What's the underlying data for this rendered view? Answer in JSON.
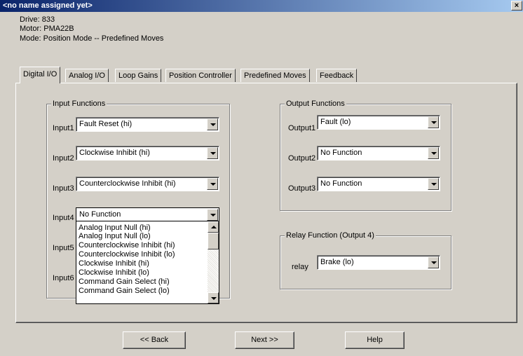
{
  "window": {
    "title": "<no name assigned yet>",
    "close_label": "×"
  },
  "info": {
    "drive": "Drive: 833",
    "motor": "Motor: PMA22B",
    "mode": "Mode: Position Mode -- Predefined Moves"
  },
  "tabs": [
    {
      "label": "Digital I/O",
      "active": true
    },
    {
      "label": "Analog I/O"
    },
    {
      "label": "Loop Gains"
    },
    {
      "label": "Position Controller"
    },
    {
      "label": "Predefined Moves"
    },
    {
      "label": "Feedback"
    }
  ],
  "input_functions": {
    "title": "Input Functions",
    "rows": [
      {
        "label": "Input1",
        "value": "Fault Reset (hi)"
      },
      {
        "label": "Input2",
        "value": "Clockwise Inhibit (hi)"
      },
      {
        "label": "Input3",
        "value": "Counterclockwise Inhibit (hi)"
      },
      {
        "label": "Input4",
        "value": "No Function"
      },
      {
        "label": "Input5"
      },
      {
        "label": "Input6"
      }
    ]
  },
  "dropdown_options": [
    "Analog Input Null (hi)",
    "Analog Input Null (lo)",
    "Counterclockwise Inhibit (hi)",
    "Counterclockwise Inhibit (lo)",
    "Clockwise Inhibit (hi)",
    "Clockwise Inhibit (lo)",
    "Command Gain Select (hi)",
    "Command Gain Select (lo)"
  ],
  "output_functions": {
    "title": "Output Functions",
    "rows": [
      {
        "label": "Output1",
        "value": "Fault (lo)"
      },
      {
        "label": "Output2",
        "value": "No Function"
      },
      {
        "label": "Output3",
        "value": "No Function"
      }
    ]
  },
  "relay_function": {
    "title": "Relay Function (Output 4)",
    "label": "relay",
    "value": "Brake (lo)"
  },
  "buttons": {
    "back": "<< Back",
    "next": "Next >>",
    "help": "Help"
  }
}
